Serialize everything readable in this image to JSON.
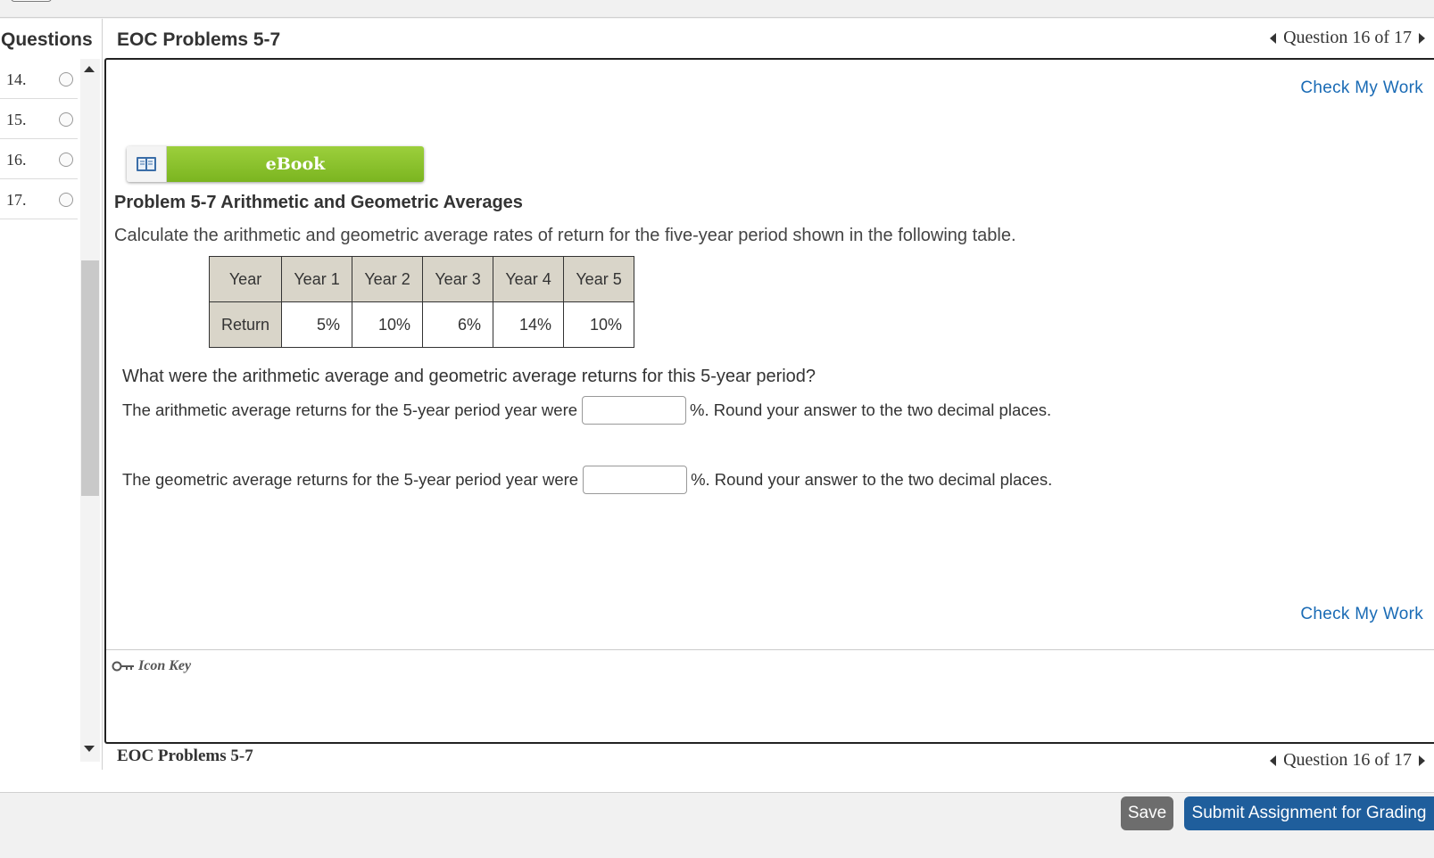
{
  "sidebar": {
    "heading": "Questions",
    "items": [
      {
        "num": "14."
      },
      {
        "num": "15."
      },
      {
        "num": "16."
      },
      {
        "num": "17."
      }
    ]
  },
  "header": {
    "assignment_title": "EOC Problems 5-7",
    "question_nav": "Question 16 of 17"
  },
  "content": {
    "check_my_work": "Check My Work",
    "ebook_label": "eBook",
    "problem_title": "Problem 5-7 Arithmetic and Geometric Averages",
    "problem_desc": "Calculate the arithmetic and geometric average rates of return for the five-year period shown in the following table.",
    "table": {
      "headers": [
        "Year",
        "Year 1",
        "Year 2",
        "Year 3",
        "Year 4",
        "Year 5"
      ],
      "row_label": "Return",
      "values": [
        "5%",
        "10%",
        "6%",
        "14%",
        "10%"
      ]
    },
    "question": "What were the arithmetic average and geometric average returns for this 5-year period?",
    "arith_prefix": "The arithmetic average returns for the 5-year period year were",
    "arith_suffix": "%. Round your answer to the two decimal places.",
    "arith_value": "",
    "geo_prefix": "The geometric average returns for the 5-year period year were",
    "geo_suffix": "%. Round your answer to the two decimal places.",
    "geo_value": "",
    "icon_key": "Icon Key"
  },
  "footer": {
    "assignment_title": "EOC Problems 5-7",
    "question_nav": "Question 16 of 17",
    "save_label": "Save",
    "submit_label": "Submit Assignment for Grading"
  },
  "colors": {
    "link": "#1a6bb5",
    "ebook_green": "#8cc233",
    "submit_blue": "#1f5e9c",
    "save_gray": "#6d6d6d",
    "table_header_bg": "#d9d5c9"
  }
}
